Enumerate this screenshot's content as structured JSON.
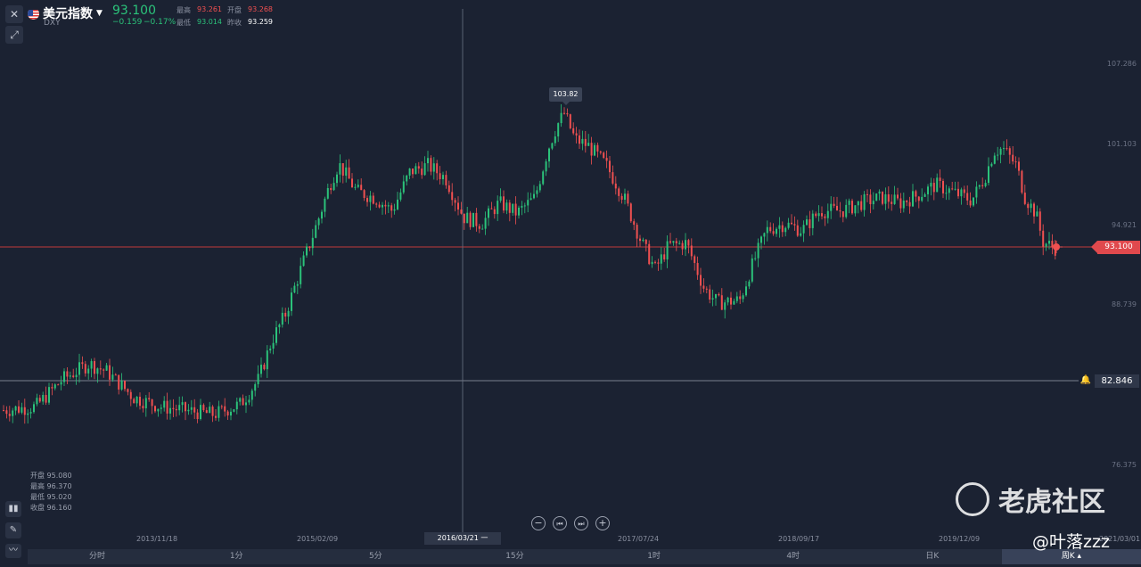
{
  "header": {
    "title": "美元指数",
    "code": "DXY",
    "price": "93.100",
    "change": "−0.159",
    "change_pct": "−0.17%",
    "high_label": "最高",
    "high": "93.261",
    "open_label": "开盘",
    "open": "93.268",
    "low_label": "最低",
    "low": "93.014",
    "prev_close_label": "昨收",
    "prev_close": "93.259"
  },
  "y_axis": [
    "107.286",
    "101.103",
    "94.921",
    "88.739",
    "76.375"
  ],
  "x_axis": [
    "2013/11/18",
    "2015/02/09",
    "2017/07/24",
    "2018/09/17",
    "2019/12/09",
    "2021/03/01"
  ],
  "tooltip_high": "103.82",
  "current_price_tag": "93.100",
  "crosshair": {
    "price": "82.846",
    "date": "2016/03/21 一"
  },
  "ohlc": {
    "open": "开盘 95.080",
    "high": "最高 96.370",
    "low": "最低 95.020",
    "close": "收盘 96.160"
  },
  "periods": [
    "分时",
    "1分",
    "5分",
    "15分",
    "1时",
    "4时",
    "日K",
    "周K ▴"
  ],
  "active_period_index": 7,
  "watermark": {
    "brand": "老虎社区",
    "user": "@叶落zzz"
  },
  "colors": {
    "background": "#1b2232",
    "up": "#2bc27a",
    "down": "#f05050",
    "price_line": "#c0393b"
  },
  "chart_data": {
    "type": "candlestick",
    "series_hint": "weekly DXY",
    "key_levels": {
      "last": 93.1,
      "high": 103.82,
      "crosshair": 82.846
    },
    "ylim": [
      76.375,
      107.286
    ],
    "path_points": [
      [
        0,
        80.6
      ],
      [
        40,
        80.9
      ],
      [
        70,
        83.0
      ],
      [
        100,
        84.2
      ],
      [
        120,
        83.6
      ],
      [
        150,
        81.6
      ],
      [
        180,
        80.9
      ],
      [
        210,
        80.6
      ],
      [
        240,
        80.3
      ],
      [
        270,
        81.1
      ],
      [
        290,
        83.0
      ],
      [
        305,
        86.0
      ],
      [
        320,
        88.0
      ],
      [
        340,
        92.0
      ],
      [
        355,
        94.9
      ],
      [
        370,
        98.0
      ],
      [
        380,
        99.6
      ],
      [
        400,
        97.5
      ],
      [
        420,
        97.0
      ],
      [
        440,
        96.0
      ],
      [
        460,
        99.0
      ],
      [
        480,
        99.5
      ],
      [
        500,
        98.5
      ],
      [
        520,
        95.5
      ],
      [
        540,
        95.0
      ],
      [
        560,
        96.6
      ],
      [
        580,
        95.8
      ],
      [
        600,
        97.0
      ],
      [
        615,
        100.8
      ],
      [
        625,
        102.6
      ],
      [
        633,
        103.5
      ],
      [
        645,
        101.5
      ],
      [
        660,
        101.0
      ],
      [
        680,
        99.5
      ],
      [
        700,
        97.0
      ],
      [
        720,
        93.5
      ],
      [
        735,
        91.5
      ],
      [
        750,
        93.3
      ],
      [
        770,
        93.5
      ],
      [
        790,
        90.0
      ],
      [
        805,
        88.9
      ],
      [
        830,
        89.1
      ],
      [
        845,
        92.0
      ],
      [
        860,
        94.5
      ],
      [
        880,
        95.0
      ],
      [
        900,
        94.5
      ],
      [
        920,
        96.0
      ],
      [
        945,
        96.0
      ],
      [
        970,
        96.7
      ],
      [
        990,
        97.0
      ],
      [
        1010,
        96.6
      ],
      [
        1030,
        97.2
      ],
      [
        1050,
        98.0
      ],
      [
        1070,
        97.4
      ],
      [
        1090,
        96.8
      ],
      [
        1105,
        98.6
      ],
      [
        1115,
        100.6
      ],
      [
        1125,
        100.8
      ],
      [
        1140,
        99.5
      ],
      [
        1150,
        97.0
      ],
      [
        1162,
        95.8
      ],
      [
        1170,
        93.6
      ],
      [
        1184,
        93.1
      ]
    ]
  }
}
